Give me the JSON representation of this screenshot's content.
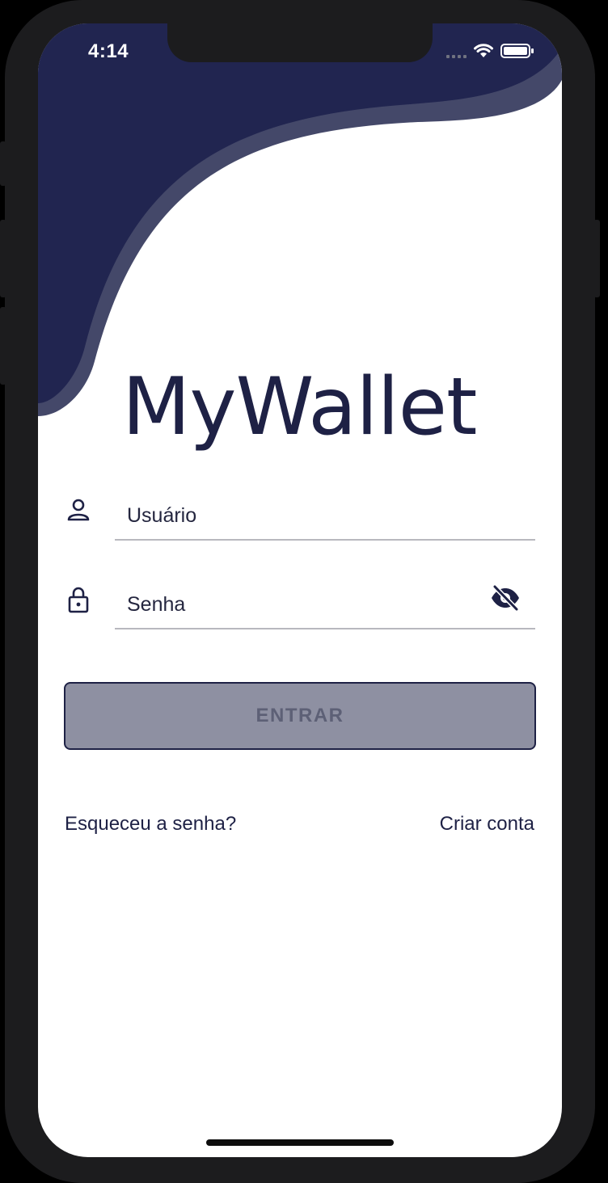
{
  "status_bar": {
    "time": "4:14"
  },
  "app": {
    "title": "MyWallet"
  },
  "form": {
    "username_label": "Usuário",
    "password_label": "Senha",
    "submit_label": "ENTRAR"
  },
  "links": {
    "forgot_password": "Esqueceu a senha?",
    "create_account": "Criar conta"
  },
  "colors": {
    "primary": "#1e2145",
    "wave_accent": "#444869",
    "button_disabled": "#8e90a2",
    "background": "#ffffff"
  },
  "icons": {
    "username": "person-icon",
    "password": "lock-icon",
    "toggle_visibility": "eye-off-icon"
  }
}
